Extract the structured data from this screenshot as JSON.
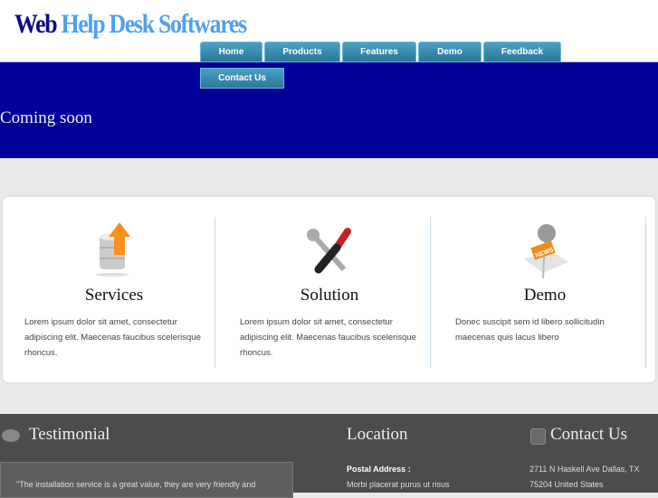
{
  "header": {
    "logo_part1": "Web",
    "logo_part2": "Help Desk Softwares"
  },
  "nav": [
    "Home",
    "Products",
    "Features",
    "Demo",
    "Feedback",
    "Contact Us"
  ],
  "hero": {
    "text": "Coming soon"
  },
  "features": [
    {
      "title": "Services",
      "text": "Lorem ipsum dolor sit amet, consectetur adipiscing elit. Maecenas faucibus scelerisque rhoncus.",
      "icon": "database-upload-icon"
    },
    {
      "title": "Solution",
      "text": "Lorem ipsum dolor sit amet, consectetur adipiscing elit. Maecenas faucibus scelerisque rhoncus.",
      "icon": "tools-icon"
    },
    {
      "title": "Demo",
      "text": "Donec suscipit sem id libero sollicitudin maecenas quis lacus libero",
      "icon": "news-microphone-icon",
      "badge": "NEWS"
    }
  ],
  "footer": {
    "testimonial_title": "Testimonial",
    "testimonial_text": "\"The installation service is a great value, they are very friendly and",
    "location_title": "Location",
    "postal_label": "Postal Address :",
    "postal_text": "Morbi placerat purus ut risus",
    "contact_title": "Contact Us",
    "address_line1": "2711 N Haskell Ave Dallas, TX",
    "address_line2": "75204 United States"
  }
}
